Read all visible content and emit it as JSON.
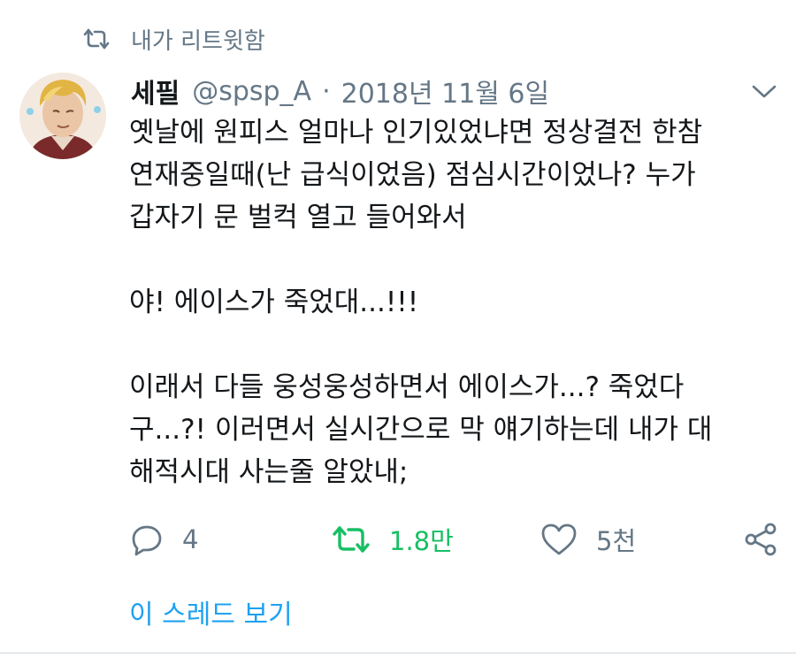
{
  "retweet_context": {
    "label": "내가 리트윗함",
    "icon": "retweet-icon"
  },
  "tweet": {
    "author_name": "세필",
    "author_handle": "@spsp_A",
    "separator": "·",
    "date": "2018년 11월 6일",
    "menu_icon": "chevron-down-icon",
    "body": {
      "paragraph1": "옛날에 원피스 얼마나 인기있었냐면 정상결전 한참\n연재중일때(난 급식이었음) 점심시간이었나? 누가\n갑자기 문 벌컥 열고 들어와서",
      "paragraph2": "야! 에이스가 죽었대...!!!",
      "paragraph3": "이래서 다들 웅성웅성하면서 에이스가...? 죽었다\n구...?! 이러면서 실시간으로 막 얘기하는데 내가 대\n해적시대 사는줄 알았내;"
    },
    "actions": {
      "reply_count": "4",
      "retweet_count": "1.8만",
      "like_count": "5천"
    },
    "colors": {
      "retweet_active": "#17bf63",
      "link": "#1da1f2",
      "muted": "#657786",
      "text": "#14171a"
    }
  },
  "thread_link": "이 스레드 보기"
}
